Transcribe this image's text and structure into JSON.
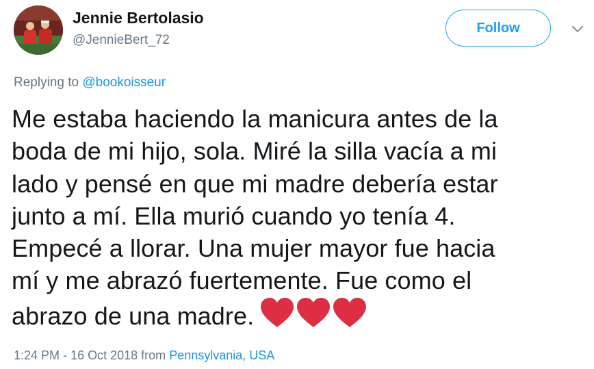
{
  "author": {
    "display_name": "Jennie Bertolasio",
    "handle": "@JennieBert_72"
  },
  "follow_label": "Follow",
  "menu_icon": "chevron-down-icon",
  "reply": {
    "prefix": "Replying to",
    "mention": "@bookoisseur"
  },
  "tweet": {
    "lines": [
      "Me estaba haciendo la manicura antes de la",
      "boda de mi hijo, sola. Miré la silla vacía a mi",
      "lado y pensé en que mi madre debería estar",
      "junto a mí. Ella murió cuando yo tenía 4.",
      "Empecé a llorar. Una mujer mayor fue hacia",
      "mí y me abrazó fuertemente. Fue como el",
      "abrazo de una madre."
    ],
    "emoji": [
      "heart-icon",
      "heart-icon",
      "heart-icon"
    ],
    "heart_color": "#dd2e44"
  },
  "footer": {
    "time": "1:24 PM",
    "separator": "-",
    "date": "16 Oct 2018",
    "from": "from",
    "location": "Pennsylvania, USA"
  },
  "colors": {
    "accent": "#1da1f2",
    "link": "#1b95e0",
    "secondary_text": "#657786",
    "primary_text": "#14171a"
  }
}
